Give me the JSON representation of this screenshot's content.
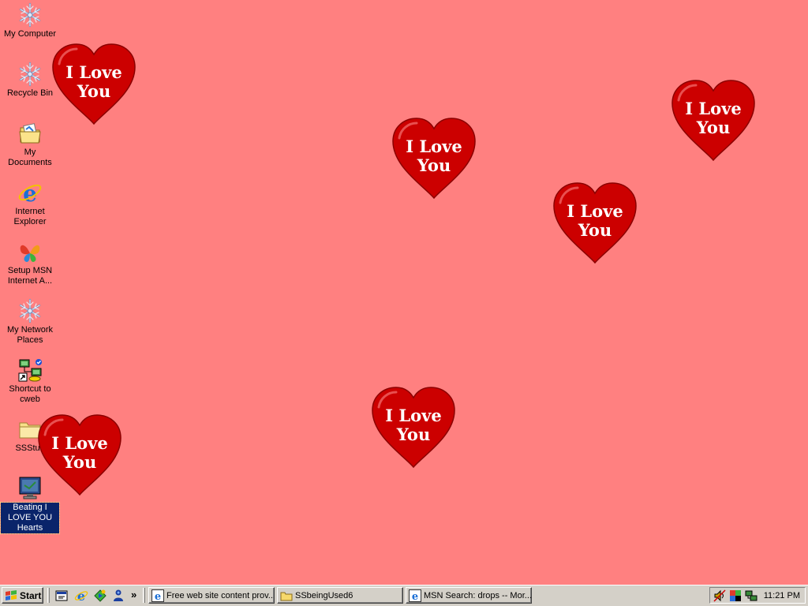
{
  "desktop": {
    "icons": [
      {
        "label": "My Computer",
        "icon": "snowflake-icon"
      },
      {
        "label": "Recycle Bin",
        "icon": "snowflake-icon"
      },
      {
        "label": "My Documents",
        "icon": "folder-icon"
      },
      {
        "label": "Internet Explorer",
        "icon": "internet-explorer-icon"
      },
      {
        "label": "Setup MSN Internet A...",
        "icon": "msn-butterfly-icon"
      },
      {
        "label": "My Network Places",
        "icon": "snowflake-icon"
      },
      {
        "label": "Shortcut to cweb",
        "icon": "network-shortcut-icon"
      },
      {
        "label": "SSStuff",
        "icon": "folder-icon"
      },
      {
        "label": "Beating I LOVE YOU Hearts",
        "icon": "screensaver-monitor-icon",
        "selected": true
      }
    ],
    "hearts": [
      {
        "line1": "I Love",
        "line2": "You"
      },
      {
        "line1": "I Love",
        "line2": "You"
      },
      {
        "line1": "I Love",
        "line2": "You"
      },
      {
        "line1": "I Love",
        "line2": "You"
      },
      {
        "line1": "I Love",
        "line2": "You"
      },
      {
        "line1": "I Love",
        "line2": "You"
      }
    ]
  },
  "taskbar": {
    "start_label": "Start",
    "quick_launch": [
      "show-desktop-icon",
      "internet-explorer-icon",
      "media-player-icon",
      "msn-messenger-icon"
    ],
    "overflow_label": "»",
    "tasks": [
      {
        "label": "Free web site content prov...",
        "icon": "internet-explorer-icon"
      },
      {
        "label": "SSbeingUsed6",
        "icon": "folder-icon"
      },
      {
        "label": "MSN Search: drops -- Mor...",
        "icon": "internet-explorer-icon"
      }
    ],
    "tray": {
      "icons": [
        "volume-icon",
        "color-display-icon",
        "network-icon"
      ],
      "clock": "11:21 PM"
    }
  },
  "colors": {
    "desktop_background": "#ff8080",
    "heart_red": "#cc0000",
    "taskbar_gray": "#d4d0c8"
  }
}
